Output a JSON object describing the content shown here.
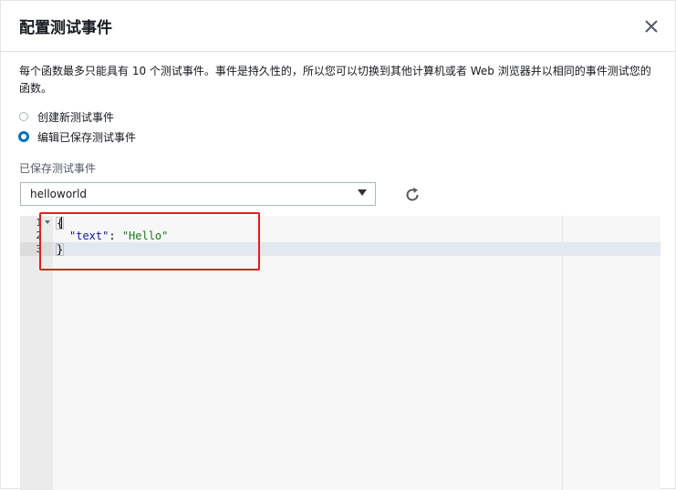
{
  "dialog": {
    "title": "配置测试事件",
    "close_icon": "close-icon",
    "description": "每个函数最多只能具有 10 个测试事件。事件是持久性的，所以您可以切换到其他计算机或者 Web 浏览器并以相同的事件测试您的函数。"
  },
  "options": [
    {
      "label": "创建新测试事件",
      "checked": false
    },
    {
      "label": "编辑已保存测试事件",
      "checked": true
    }
  ],
  "saved_events": {
    "label": "已保存测试事件",
    "selected": "helloworld",
    "refresh_icon": "refresh-icon"
  },
  "editor": {
    "line_numbers": [
      "1",
      "2",
      "3"
    ],
    "lines": {
      "l1": "{",
      "l2_key": "\"text\"",
      "l2_sep": ": ",
      "l2_val": "\"Hello\"",
      "l3": "}"
    }
  },
  "colors": {
    "accent": "#0073bb",
    "annotation": "#e02020",
    "json_key": "#0a1a9c",
    "json_string": "#1a7a1a"
  }
}
